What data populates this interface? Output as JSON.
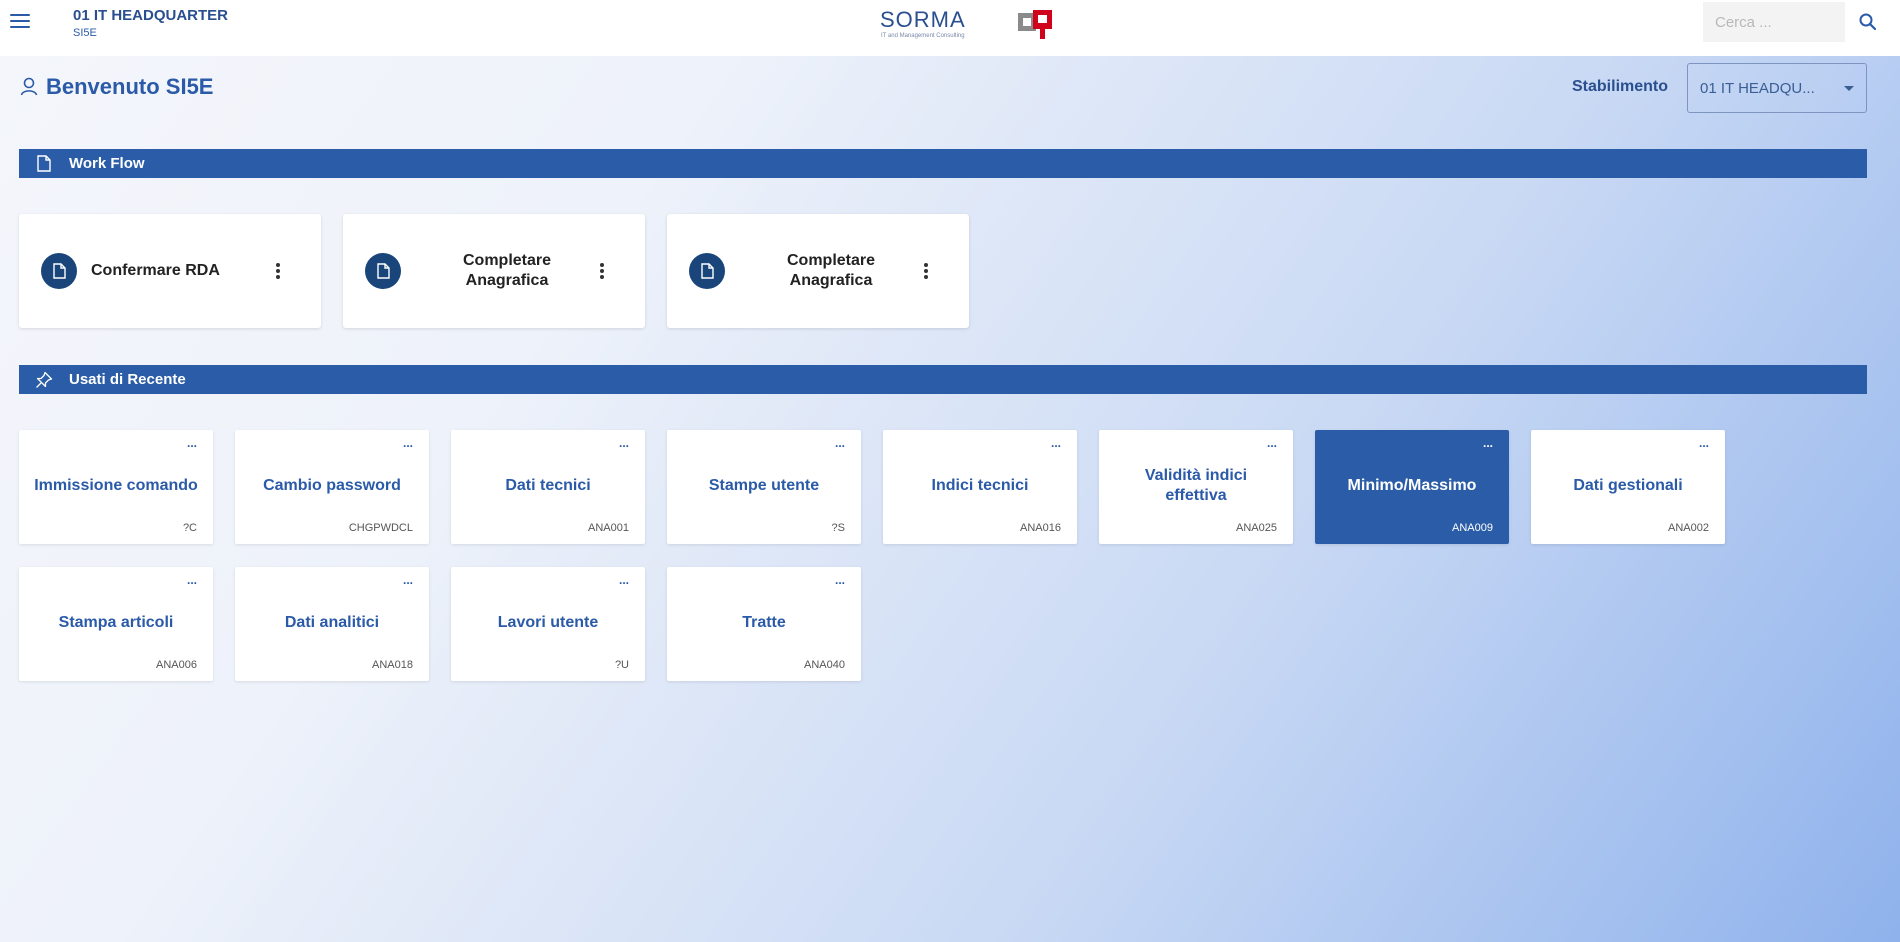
{
  "header": {
    "company_name": "01 IT HEADQUARTER",
    "user_code": "SI5E",
    "logo_text": "SORMA",
    "logo_tagline": "IT and Management Consulting",
    "search_placeholder": "Cerca ...",
    "icons": {
      "menu": "hamburger-icon",
      "search": "search-icon"
    }
  },
  "welcome": {
    "text": "Benvenuto SI5E",
    "icon": "user-icon"
  },
  "plant": {
    "label": "Stabilimento",
    "value": "01 IT HEADQU..."
  },
  "workflow": {
    "title": "Work Flow",
    "icon": "document-icon",
    "cards": [
      {
        "label": "Confermare RDA"
      },
      {
        "label": "Completare Anagrafica"
      },
      {
        "label": "Completare Anagrafica"
      }
    ]
  },
  "recent": {
    "title": "Usati di Recente",
    "icon": "pin-icon",
    "tiles": [
      {
        "title": "Immissione comando",
        "code": "?C",
        "active": false
      },
      {
        "title": "Cambio password",
        "code": "CHGPWDCL",
        "active": false
      },
      {
        "title": "Dati tecnici",
        "code": "ANA001",
        "active": false
      },
      {
        "title": "Stampe utente",
        "code": "?S",
        "active": false
      },
      {
        "title": "Indici tecnici",
        "code": "ANA016",
        "active": false
      },
      {
        "title": "Validità indici effettiva",
        "code": "ANA025",
        "active": false
      },
      {
        "title": "Minimo/Massimo",
        "code": "ANA009",
        "active": true
      },
      {
        "title": "Dati gestionali",
        "code": "ANA002",
        "active": false
      },
      {
        "title": "Stampa articoli",
        "code": "ANA006",
        "active": false
      },
      {
        "title": "Dati analitici",
        "code": "ANA018",
        "active": false
      },
      {
        "title": "Lavori utente",
        "code": "?U",
        "active": false
      },
      {
        "title": "Tratte",
        "code": "ANA040",
        "active": false
      }
    ],
    "tile_menu_glyph": "..."
  },
  "colors": {
    "primary": "#2b5ca7",
    "dark_circle": "#19457a",
    "logo_red": "#d0021b"
  }
}
